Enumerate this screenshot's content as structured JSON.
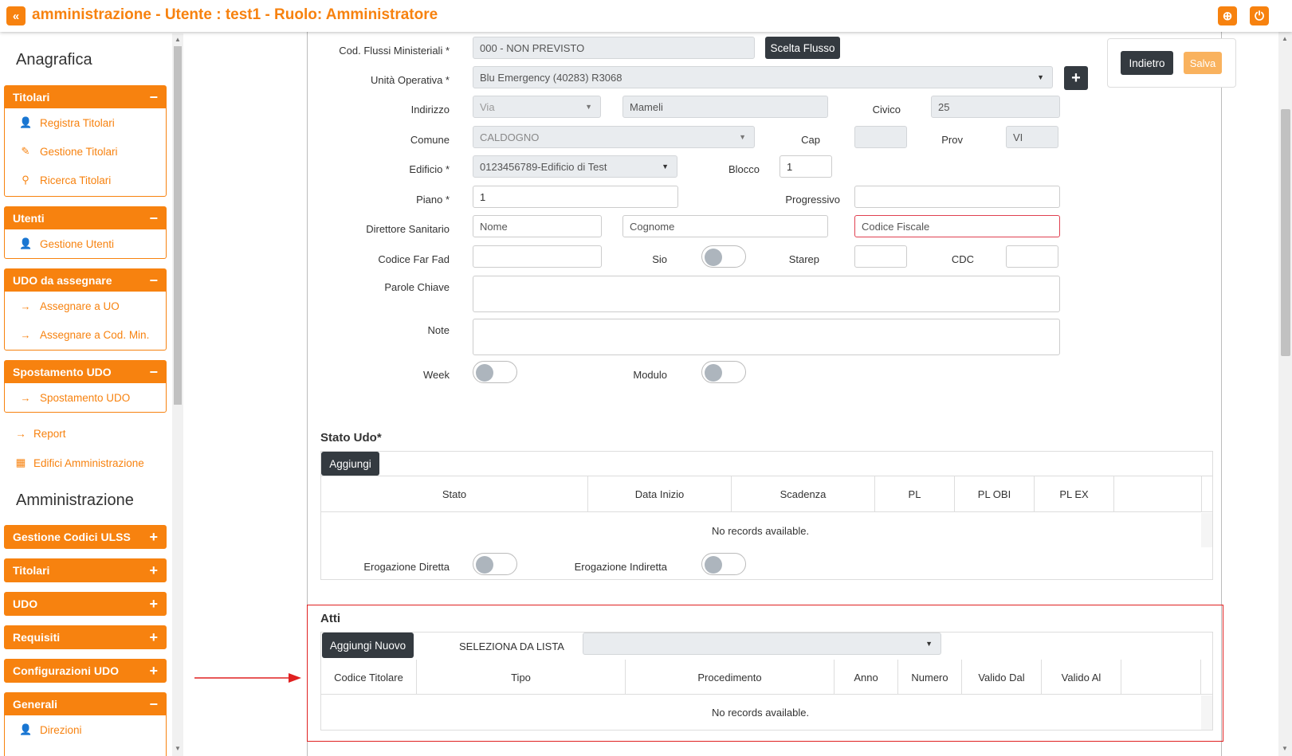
{
  "header": {
    "title": "amministrazione - Utente : test1 - Ruolo: Amministratore",
    "collapse_icon": "«",
    "globe_icon": "⊕",
    "power_icon": "⏻"
  },
  "sidebar": {
    "anagrafica_heading": "Anagrafica",
    "amministrazione_heading": "Amministrazione",
    "titolari": {
      "label": "Titolari",
      "sign": "−",
      "items": [
        "Registra Titolari",
        "Gestione Titolari",
        "Ricerca Titolari"
      ]
    },
    "utenti": {
      "label": "Utenti",
      "sign": "−",
      "items": [
        "Gestione Utenti"
      ]
    },
    "udo_assegnare": {
      "label": "UDO da assegnare",
      "sign": "−",
      "items": [
        "Assegnare a UO",
        "Assegnare a Cod. Min."
      ]
    },
    "spostamento": {
      "label": "Spostamento UDO",
      "sign": "−",
      "items": [
        "Spostamento UDO"
      ]
    },
    "links": [
      "Report",
      "Edifici Amministrazione"
    ],
    "admin_groups": [
      {
        "label": "Gestione Codici ULSS",
        "sign": "+"
      },
      {
        "label": "Titolari",
        "sign": "+"
      },
      {
        "label": "UDO",
        "sign": "+"
      },
      {
        "label": "Requisiti",
        "sign": "+"
      },
      {
        "label": "Configurazioni UDO",
        "sign": "+"
      }
    ],
    "generali": {
      "label": "Generali",
      "sign": "−",
      "items": [
        "Direzioni"
      ]
    }
  },
  "actions": {
    "back_label": "Indietro",
    "save_label": "Salva"
  },
  "form": {
    "cod_flussi_label": "Cod. Flussi Ministeriali *",
    "cod_flussi_value": "000 - NON PREVISTO",
    "scelta_flusso_label": "Scelta Flusso",
    "unita_label": "Unità Operativa *",
    "unita_value": "Blu Emergency (40283) R3068",
    "add_icon": "+",
    "indirizzo_label": "Indirizzo",
    "indirizzo_tipo": "Via",
    "indirizzo_nome": "Mameli",
    "civico_label": "Civico",
    "civico_value": "25",
    "comune_label": "Comune",
    "comune_value": "CALDOGNO",
    "cap_label": "Cap",
    "cap_value": "",
    "prov_label": "Prov",
    "prov_value": "VI",
    "edificio_label": "Edificio *",
    "edificio_value": "0123456789-Edificio di Test",
    "blocco_label": "Blocco",
    "blocco_value": "1",
    "piano_label": "Piano *",
    "piano_value": "1",
    "progressivo_label": "Progressivo",
    "progressivo_value": "",
    "direttore_label": "Direttore Sanitario",
    "nome_placeholder": "Nome",
    "cognome_placeholder": "Cognome",
    "cf_placeholder": "Codice Fiscale",
    "far_fad_label": "Codice Far Fad",
    "sio_label": "Sio",
    "starep_label": "Starep",
    "cdc_label": "CDC",
    "parole_label": "Parole Chiave",
    "note_label": "Note",
    "week_label": "Week",
    "modulo_label": "Modulo"
  },
  "stato": {
    "title": "Stato Udo*",
    "add_label": "Aggiungi",
    "columns": [
      "Stato",
      "Data Inizio",
      "Scadenza",
      "PL",
      "PL OBI",
      "PL EX"
    ],
    "empty": "No records available.",
    "erogazione_diretta_label": "Erogazione Diretta",
    "erogazione_indiretta_label": "Erogazione Indiretta"
  },
  "atti": {
    "title": "Atti",
    "add_label": "Aggiungi Nuovo",
    "select_label": "SELEZIONA DA LISTA",
    "columns": [
      "Codice Titolare",
      "Tipo",
      "Procedimento",
      "Anno",
      "Numero",
      "Valido Dal",
      "Valido Al"
    ],
    "empty": "No records available."
  },
  "colors": {
    "accent": "#f7820f",
    "dark_button": "#343a40",
    "highlight": "#e02020"
  }
}
